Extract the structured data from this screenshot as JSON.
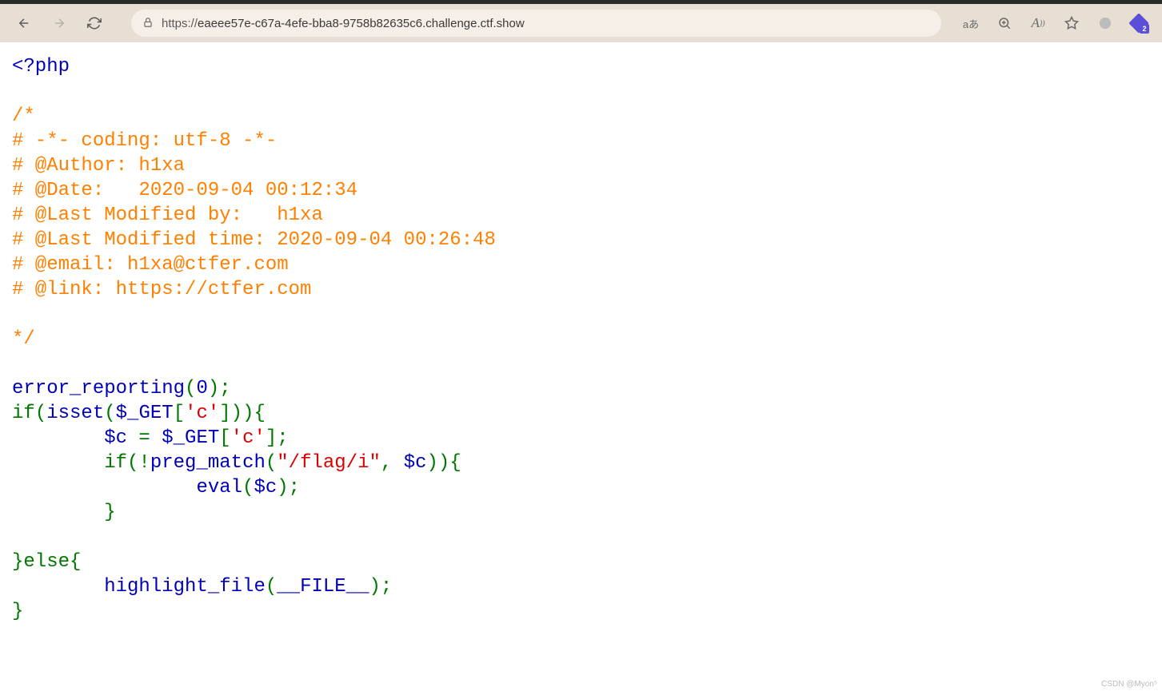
{
  "browser": {
    "url_prefix": "https://",
    "url_host": "eaeee57e-c67a-4efe-bba8-9758b82635c6.challenge.ctf.show",
    "translate_label": "aあ",
    "extension_badge": "2"
  },
  "code": {
    "php_open": "<?php",
    "comment_open": "/*",
    "c1": "# -*- coding: utf-8 -*-",
    "c2": "# @Author: h1xa",
    "c3": "# @Date:   2020-09-04 00:12:34",
    "c4": "# @Last Modified by:   h1xa",
    "c5": "# @Last Modified time: 2020-09-04 00:26:48",
    "c6": "# @email: h1xa@ctfer.com",
    "c7": "# @link: https://ctfer.com",
    "comment_close": "*/",
    "fn_error_reporting": "error_reporting",
    "zero": "0",
    "if": "if",
    "fn_isset": "isset",
    "var_get": "$_GET",
    "key_c": "'c'",
    "var_c": "$c",
    "assign": " = ",
    "fn_preg_match": "preg_match",
    "regex": "\"/flag/i\"",
    "fn_eval": "eval",
    "else": "else",
    "fn_highlight": "highlight_file",
    "const_file": "__FILE__"
  },
  "watermark": "CSDN @Myon⁵"
}
